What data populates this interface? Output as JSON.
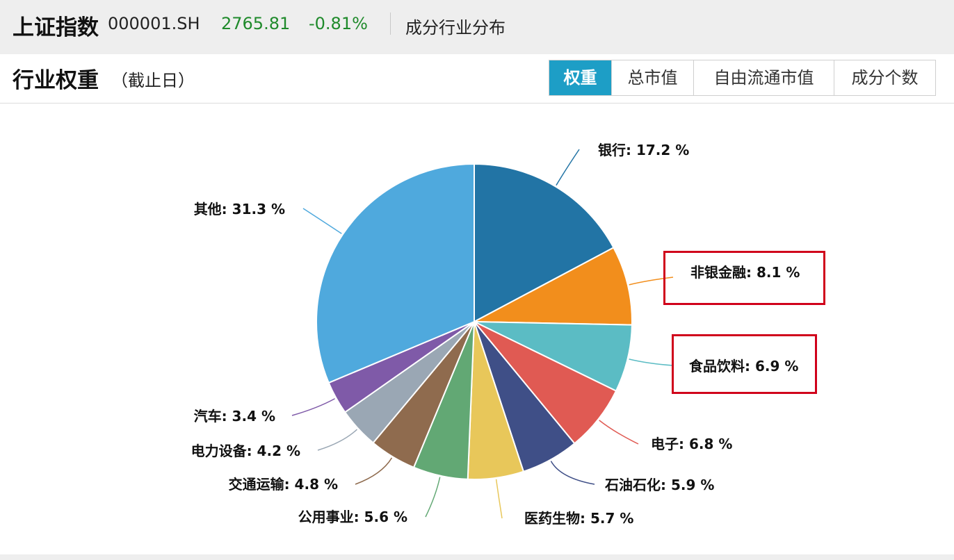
{
  "header": {
    "index_name": "上证指数",
    "index_code": "000001.SH",
    "price": "2765.81",
    "change": "-0.81%",
    "page_title": "成分行业分布"
  },
  "card": {
    "title": "行业权重",
    "subtitle": "（截止日）",
    "tabs": [
      {
        "label": "权重",
        "active": true
      },
      {
        "label": "总市值",
        "active": false
      },
      {
        "label": "自由流通市值",
        "active": false
      },
      {
        "label": "成分个数",
        "active": false
      }
    ]
  },
  "colors": {
    "accent": "#1d9ec6",
    "price_green": "#1f8a2b",
    "highlight": "#d0021b"
  },
  "chart_data": {
    "type": "pie",
    "title": "",
    "series": [
      {
        "name": "",
        "values": [
          17.2,
          8.1,
          6.9,
          6.8,
          5.9,
          5.7,
          5.6,
          4.8,
          4.2,
          3.4,
          31.3
        ]
      }
    ],
    "categories": [
      "银行",
      "非银金融",
      "食品饮料",
      "电子",
      "石油石化",
      "医药生物",
      "公用事业",
      "交通运输",
      "电力设备",
      "汽车",
      "其他"
    ],
    "labels": [
      "银行: 17.2 %",
      "非银金融: 8.1 %",
      "食品饮料: 6.9 %",
      "电子: 6.8 %",
      "石油石化: 5.9 %",
      "医药生物: 5.7 %",
      "公用事业: 5.6 %",
      "交通运输: 4.8 %",
      "电力设备: 4.2 %",
      "汽车: 3.4 %",
      "其他: 31.3 %"
    ],
    "slice_colors": [
      "#2274a5",
      "#f28e1c",
      "#5bbcc4",
      "#e05a53",
      "#3f4f87",
      "#e8c75a",
      "#62a874",
      "#8f6b4e",
      "#9aa7b4",
      "#7f5aa8",
      "#4fa9dd"
    ],
    "start_angle": "12 o'clock",
    "direction": "clockwise",
    "highlighted": [
      "非银金融",
      "食品饮料"
    ]
  }
}
